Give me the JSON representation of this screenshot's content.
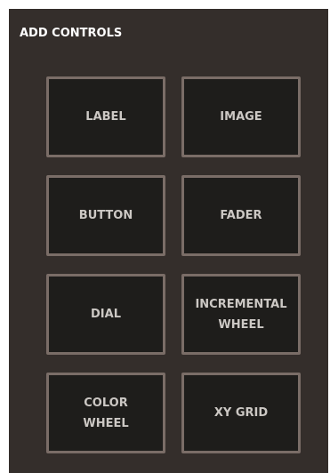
{
  "panel": {
    "title": "ADD CONTROLS"
  },
  "controls": [
    {
      "label": "LABEL"
    },
    {
      "label": "IMAGE"
    },
    {
      "label": "BUTTON"
    },
    {
      "label": "FADER"
    },
    {
      "label": "DIAL"
    },
    {
      "label": "INCREMENTAL\nWHEEL"
    },
    {
      "label": "COLOR\nWHEEL"
    },
    {
      "label": "XY GRID"
    }
  ],
  "colors": {
    "panel_background": "#342e2b",
    "button_background": "#1e1d1b",
    "button_border": "#7a6d67",
    "button_text": "#ccc8c4",
    "title_text": "#ffffff"
  }
}
